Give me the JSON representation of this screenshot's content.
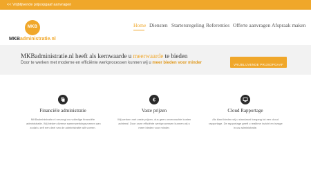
{
  "topbar": {
    "link": "<< Vrijblijvende prijsopgaaf aanvragen"
  },
  "logo": {
    "badge": "MKB",
    "wordmark_primary": "MKB",
    "wordmark_secondary": "administratie.nl"
  },
  "nav": {
    "items": [
      {
        "label": "Home"
      },
      {
        "label": "Diensten"
      },
      {
        "label": "Startersregeling"
      },
      {
        "label": "Referenties"
      },
      {
        "label": "Offerte aanvragen"
      },
      {
        "label": "Afspraak maken"
      }
    ]
  },
  "intro": {
    "headline_before": "MKBadministratie.nl heeft als kernwaarde u ",
    "headline_accent": "meerwaarde",
    "headline_after": " te bieden",
    "subline_before": "Door te werken met moderne en efficiënte werkprocessen kunnen wij u ",
    "subline_accent": "meer bieden voor minder",
    "cta_label": "VRIJBLIJVENDE PRIJSOPGAAF"
  },
  "features": [
    {
      "icon": "document-icon",
      "title": "Financiële administratie",
      "desc_lines": [
        "MKBadministratie.nl verzorgt uw volledige financiële",
        "administratie. Wij bieden diverse samenwerkingsvormen aan",
        "zodat u zelf een deel van de administratie wilt voeren."
      ]
    },
    {
      "icon": "euro-icon",
      "title": "Vaste prijzen",
      "desc_lines": [
        "Wij werken met vaste prijzen, dus geen onverwachte kosten",
        "achteraf. Door onze efficiënte werkprocessen kunnen wij u",
        "meer bieden voor minder."
      ]
    },
    {
      "icon": "monitor-icon",
      "title": "Cloud Rapportage",
      "desc_lines": [
        "Als klant bieden wij u standaard toegang tot een cloud",
        "rapportage. De rapportage geeft u realtime inzicht en inzage",
        "in uw administratie."
      ]
    }
  ],
  "colors": {
    "accent": "#f0a72a",
    "band": "#f2f2f2",
    "icon_bg": "#2a2a2a"
  }
}
